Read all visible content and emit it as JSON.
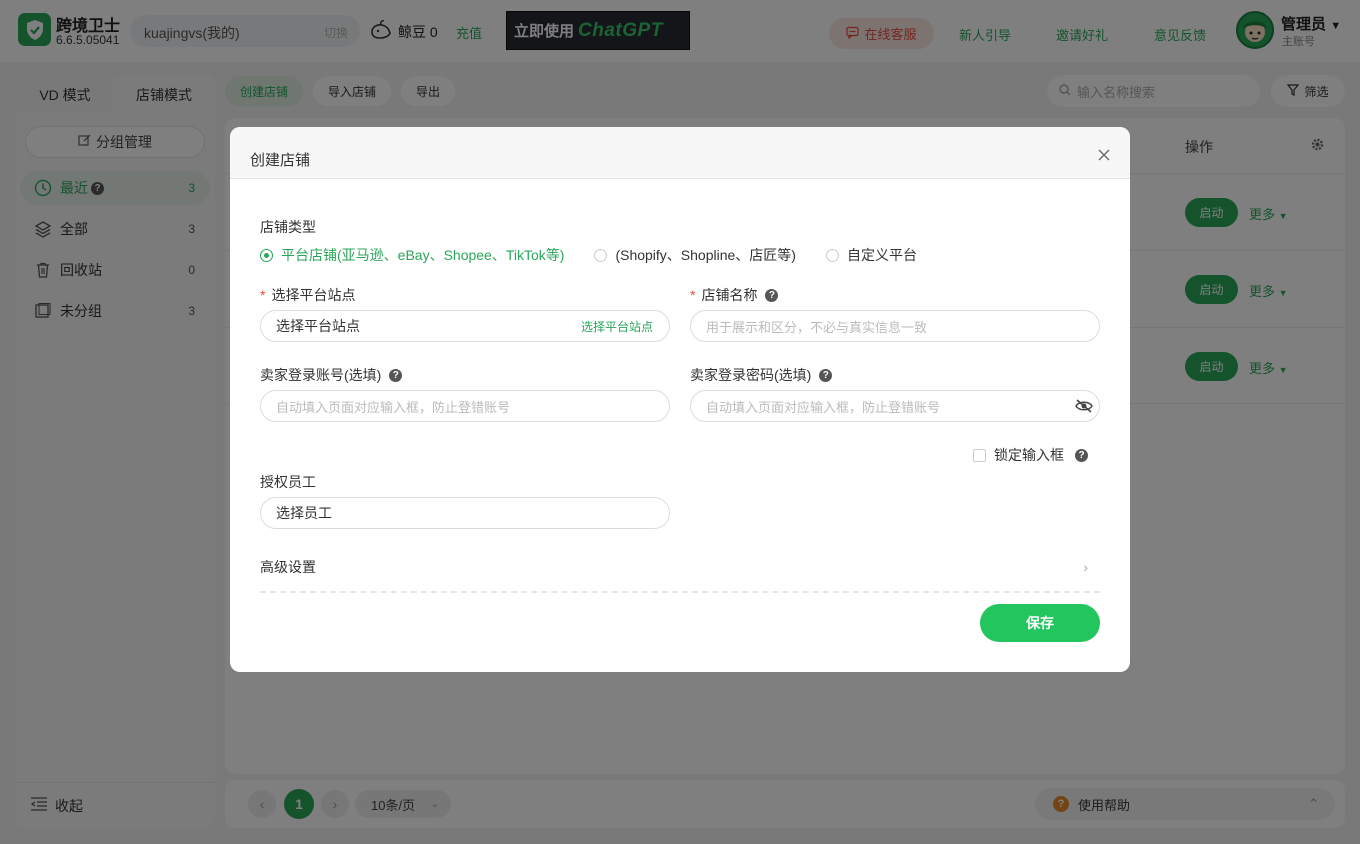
{
  "app": {
    "name": "跨境卫士",
    "version": "6.6.5.05041"
  },
  "account": {
    "name": "kuajingvs(我的)",
    "switch_label": "切换"
  },
  "beans": {
    "label": "鲸豆 0",
    "recharge": "充值"
  },
  "banner": {
    "text_a": "立即使用",
    "text_b": "ChatGPT"
  },
  "header_nav": {
    "service": "在线客服",
    "guide": "新人引导",
    "invite": "邀请好礼",
    "feedback": "意见反馈"
  },
  "user": {
    "name": "管理员",
    "role": "主账号"
  },
  "mode_tabs": {
    "vd": "VD 模式",
    "store": "店铺模式"
  },
  "sidebar": {
    "group_manage": "分组管理",
    "items": [
      {
        "label": "最近",
        "count": "3"
      },
      {
        "label": "全部",
        "count": "3"
      },
      {
        "label": "回收站",
        "count": "0"
      },
      {
        "label": "未分组",
        "count": "3"
      }
    ],
    "collapse": "收起"
  },
  "toolbar": {
    "create": "创建店铺",
    "import": "导入店铺",
    "export": "导出",
    "search_placeholder": "输入名称搜索",
    "filter": "筛选"
  },
  "table": {
    "ops_header": "操作",
    "rows": [
      {
        "start": "启动",
        "more": "更多"
      },
      {
        "start": "启动",
        "more": "更多"
      },
      {
        "start": "启动",
        "more": "更多"
      }
    ]
  },
  "pagination": {
    "current": "1",
    "page_size": "10条/页",
    "help": "使用帮助"
  },
  "modal": {
    "title": "创建店铺",
    "store_type_label": "店铺类型",
    "store_types": [
      {
        "label": "平台店铺(亚马逊、eBay、Shopee、TikTok等)",
        "selected": true
      },
      {
        "label": "(Shopify、Shopline、店匠等)",
        "selected": false
      },
      {
        "label": "自定义平台",
        "selected": false
      }
    ],
    "site_label": "选择平台站点",
    "site_value": "选择平台站点",
    "site_action": "选择平台站点",
    "store_name_label": "店铺名称",
    "store_name_placeholder": "用于展示和区分，不必与真实信息一致",
    "seller_account_label": "卖家登录账号(选填)",
    "seller_account_placeholder": "自动填入页面对应输入框，防止登错账号",
    "seller_password_label": "卖家登录密码(选填)",
    "seller_password_placeholder": "自动填入页面对应输入框，防止登错账号",
    "lock_label": "锁定输入框",
    "staff_label": "授权员工",
    "staff_value": "选择员工",
    "advanced": "高级设置",
    "save": "保存"
  },
  "colors": {
    "brand": "#2aa65a",
    "save": "#22c55e",
    "danger": "#e74c3c"
  }
}
